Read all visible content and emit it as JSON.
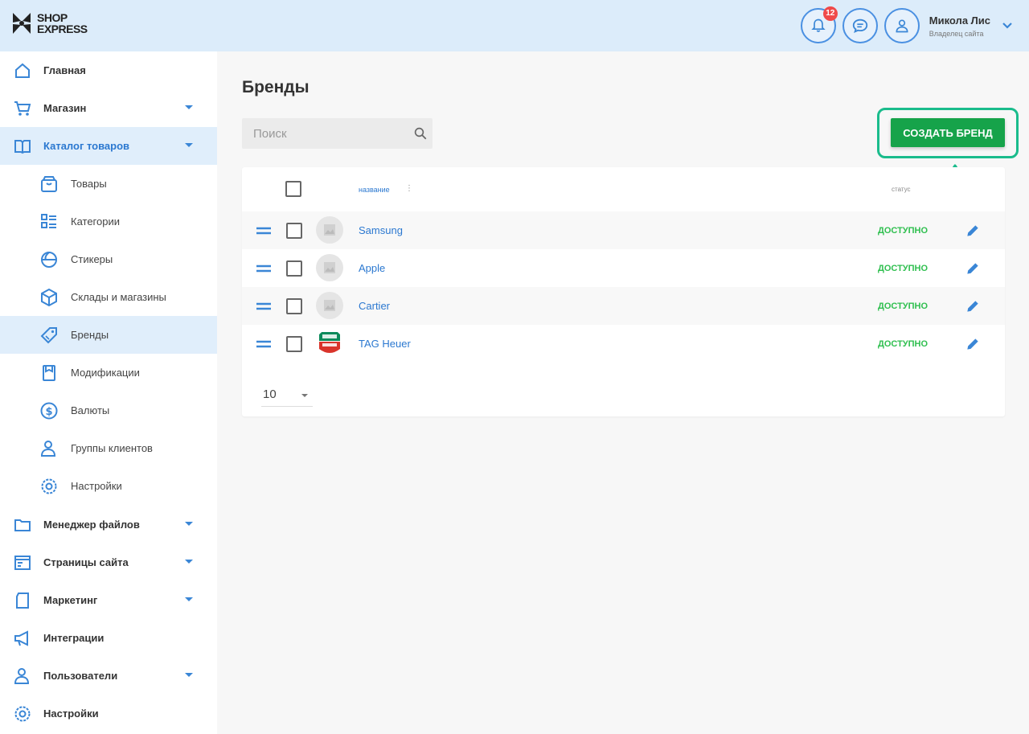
{
  "header": {
    "logo_line1": "SHOP",
    "logo_line2": "EXPRESS",
    "notifications_count": "12",
    "user": {
      "name": "Микола Лис",
      "role": "Владелец сайта"
    }
  },
  "sidebar": {
    "items": [
      {
        "label": "Главная",
        "icon": "home-icon"
      },
      {
        "label": "Магазин",
        "icon": "cart-icon",
        "expandable": true
      },
      {
        "label": "Каталог товаров",
        "icon": "book-icon",
        "expandable": true,
        "active": true
      },
      {
        "label": "Товары",
        "icon": "box-icon",
        "sub": true
      },
      {
        "label": "Категории",
        "icon": "categories-icon",
        "sub": true
      },
      {
        "label": "Стикеры",
        "icon": "sticker-icon",
        "sub": true
      },
      {
        "label": "Склады и магазины",
        "icon": "warehouse-icon",
        "sub": true
      },
      {
        "label": "Бренды",
        "icon": "tag-icon",
        "sub": true,
        "active": true
      },
      {
        "label": "Модификации",
        "icon": "modification-icon",
        "sub": true
      },
      {
        "label": "Валюты",
        "icon": "currency-icon",
        "sub": true
      },
      {
        "label": "Группы клиентов",
        "icon": "client-group-icon",
        "sub": true
      },
      {
        "label": "Настройки",
        "icon": "gear-icon",
        "sub": true
      },
      {
        "label": "Менеджер файлов",
        "icon": "folder-icon",
        "expandable": true
      },
      {
        "label": "Страницы сайта",
        "icon": "pages-icon",
        "expandable": true
      },
      {
        "label": "Маркетинг",
        "icon": "marketing-icon",
        "expandable": true
      },
      {
        "label": "Интеграции",
        "icon": "megaphone-icon"
      },
      {
        "label": "Пользователи",
        "icon": "users-icon",
        "expandable": true
      },
      {
        "label": "Настройки",
        "icon": "gear-icon"
      }
    ]
  },
  "page": {
    "title": "Бренды",
    "search_placeholder": "Поиск",
    "create_button": "СОЗДАТЬ БРЕНД"
  },
  "table": {
    "columns": {
      "name": "название",
      "status": "статус"
    },
    "rows": [
      {
        "name": "Samsung",
        "status": "ДОСТУПНО",
        "thumb": "placeholder"
      },
      {
        "name": "Apple",
        "status": "ДОСТУПНО",
        "thumb": "placeholder"
      },
      {
        "name": "Cartier",
        "status": "ДОСТУПНО",
        "thumb": "placeholder"
      },
      {
        "name": "TAG Heuer",
        "status": "ДОСТУПНО",
        "thumb": "tag-heuer-logo"
      }
    ],
    "per_page": "10"
  },
  "colors": {
    "accent_blue": "#2b78d0",
    "header_bg": "#dcecfa",
    "create_green": "#16a34a",
    "highlight_teal": "#1abc8c",
    "status_green": "#2fbf4f",
    "badge_red": "#f04a4a"
  }
}
